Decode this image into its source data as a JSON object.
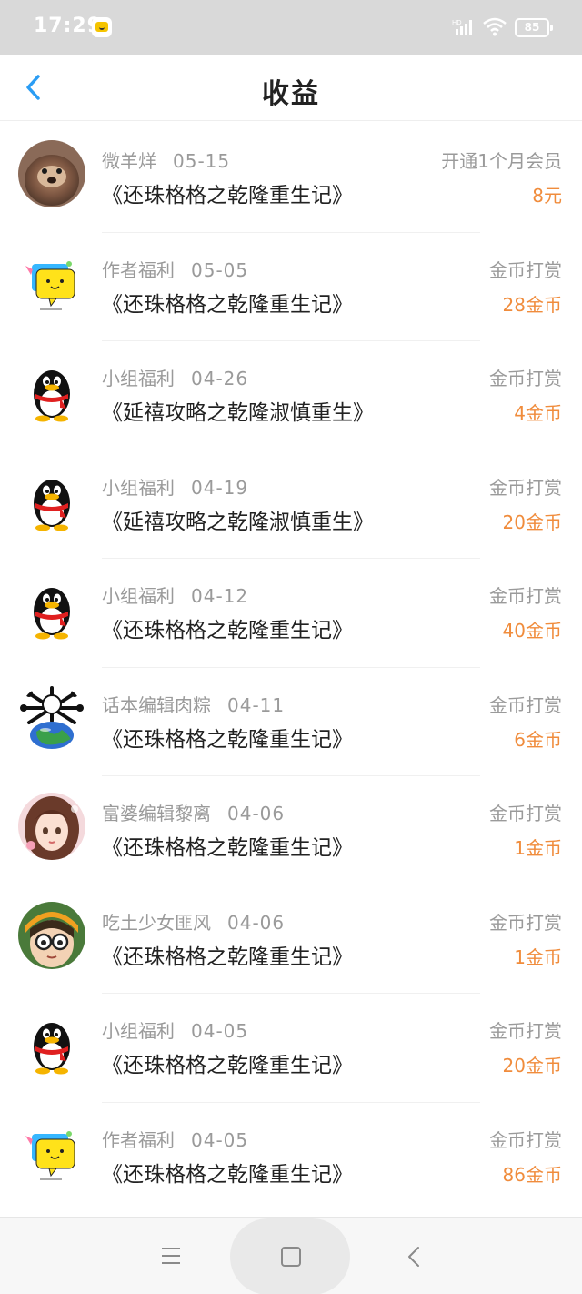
{
  "status_bar": {
    "time": "17:29",
    "battery": "85",
    "network": "HD"
  },
  "header": {
    "title": "收益"
  },
  "colors": {
    "accent": "#2a9df4",
    "amount": "#f08c3c",
    "muted": "#9a9a9a"
  },
  "entries": [
    {
      "avatar": "otter-photo-avatar",
      "sender": "微羊烊",
      "date": "05-15",
      "book": "《还珠格格之乾隆重生记》",
      "type": "开通1个月会员",
      "amount": "8元"
    },
    {
      "avatar": "speech-bubble-mascot-avatar",
      "sender": "作者福利",
      "date": "05-05",
      "book": "《还珠格格之乾隆重生记》",
      "type": "金币打赏",
      "amount": "28金币"
    },
    {
      "avatar": "penguin-avatar",
      "sender": "小组福利",
      "date": "04-26",
      "book": "《延禧攻略之乾隆淑慎重生》",
      "type": "金币打赏",
      "amount": "4金币"
    },
    {
      "avatar": "penguin-avatar",
      "sender": "小组福利",
      "date": "04-19",
      "book": "《延禧攻略之乾隆淑慎重生》",
      "type": "金币打赏",
      "amount": "20金币"
    },
    {
      "avatar": "penguin-avatar",
      "sender": "小组福利",
      "date": "04-12",
      "book": "《还珠格格之乾隆重生记》",
      "type": "金币打赏",
      "amount": "40金币"
    },
    {
      "avatar": "globe-bones-avatar",
      "sender": "话本编辑肉粽",
      "date": "04-11",
      "book": "《还珠格格之乾隆重生记》",
      "type": "金币打赏",
      "amount": "6金币"
    },
    {
      "avatar": "anime-girl-avatar",
      "sender": "富婆编辑黎离",
      "date": "04-06",
      "book": "《还珠格格之乾隆重生记》",
      "type": "金币打赏",
      "amount": "1金币"
    },
    {
      "avatar": "cartoon-glasses-avatar",
      "sender": "吃土少女匪风",
      "date": "04-06",
      "book": "《还珠格格之乾隆重生记》",
      "type": "金币打赏",
      "amount": "1金币"
    },
    {
      "avatar": "penguin-avatar",
      "sender": "小组福利",
      "date": "04-05",
      "book": "《还珠格格之乾隆重生记》",
      "type": "金币打赏",
      "amount": "20金币"
    },
    {
      "avatar": "speech-bubble-mascot-avatar",
      "sender": "作者福利",
      "date": "04-05",
      "book": "《还珠格格之乾隆重生记》",
      "type": "金币打赏",
      "amount": "86金币"
    }
  ]
}
